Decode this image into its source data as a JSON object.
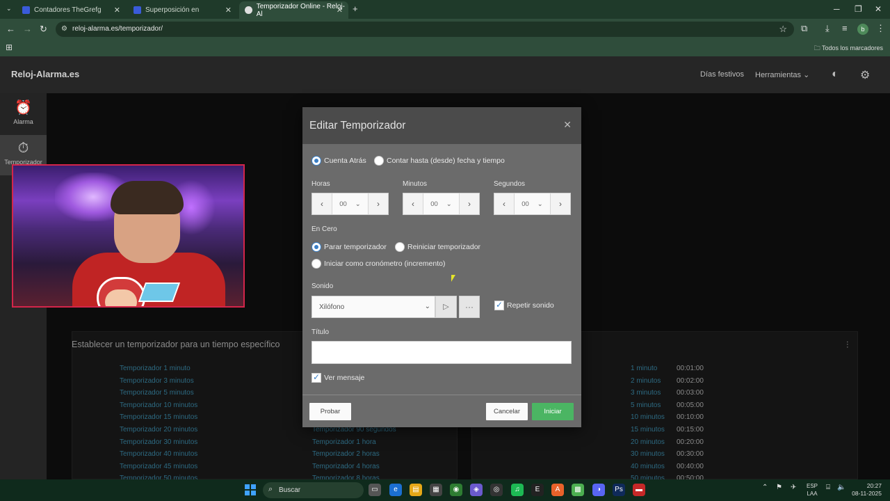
{
  "browser": {
    "tabs": [
      {
        "label": "Contadores TheGrefg"
      },
      {
        "label": "Superposición en"
      },
      {
        "label": "Temporizador Online - Reloj-Al"
      }
    ],
    "new_tab": "+",
    "url": "reloj-alarma.es/temporizador/",
    "bookmarks_all": "Todos los marcadores",
    "profile_initial": "b"
  },
  "site": {
    "logo": "Reloj-Alarma.es",
    "nav": [
      "Días festivos",
      "Herramientas"
    ],
    "sidebar": [
      {
        "label": "Alarma",
        "icon": "alarm-clock-icon"
      },
      {
        "label": "Temporizador",
        "icon": "timer-icon"
      }
    ],
    "panel_title": "Establecer un temporizador para un tiempo específico",
    "list_a": [
      "Temporizador 1 minuto",
      "Temporizador 3 minutos",
      "Temporizador 5 minutos",
      "Temporizador 10 minutos",
      "Temporizador 15 minutos",
      "Temporizador 20 minutos",
      "Temporizador 30 minutos",
      "Temporizador 40 minutos",
      "Temporizador 45 minutos",
      "Temporizador 50 minutos"
    ],
    "list_b": [
      "Temporizador 90 segundos",
      "Temporizador 1 hora",
      "Temporizador 2 horas",
      "Temporizador 4 horas",
      "Temporizador 8 horas"
    ],
    "list_c": [
      "1 minuto",
      "2 minutos",
      "3 minutos",
      "5 minutos",
      "10 minutos",
      "15 minutos",
      "20 minutos",
      "30 minutos",
      "40 minutos",
      "50 minutos"
    ],
    "list_d": [
      "00:01:00",
      "00:02:00",
      "00:03:00",
      "00:05:00",
      "00:10:00",
      "00:15:00",
      "00:20:00",
      "00:30:00",
      "00:40:00",
      "00:50:00"
    ]
  },
  "modal": {
    "title": "Editar Temporizador",
    "mode_options": [
      "Cuenta Atrás",
      "Contar hasta (desde) fecha y tiempo"
    ],
    "mode_selected": "Cuenta Atrás",
    "hours_label": "Horas",
    "minutes_label": "Minutos",
    "seconds_label": "Segundos",
    "hours_value": "00",
    "minutes_value": "00",
    "seconds_value": "00",
    "at_zero_label": "En Cero",
    "at_zero_options": [
      "Parar temporizador",
      "Reiniciar temporizador",
      "Iniciar como cronómetro (incremento)"
    ],
    "at_zero_selected": "Parar temporizador",
    "sound_label": "Sonido",
    "sound_value": "Xilófono",
    "repeat_sound_label": "Repetir sonido",
    "repeat_sound_checked": true,
    "title_field_label": "Título",
    "title_field_value": "",
    "show_message_label": "Ver mensaje",
    "show_message_checked": true,
    "test_button": "Probar",
    "cancel_button": "Cancelar",
    "start_button": "Iniciar"
  },
  "taskbar": {
    "search_label": "Buscar",
    "lang_top": "ESP",
    "lang_bottom": "LAA",
    "time": "20:27",
    "date": "08-11-2025"
  },
  "colors": {
    "accent_green": "#4bb563",
    "radio_blue": "#3a7fc6",
    "cam_border": "#d4254a",
    "browser_frame": "#2f4d3b"
  }
}
